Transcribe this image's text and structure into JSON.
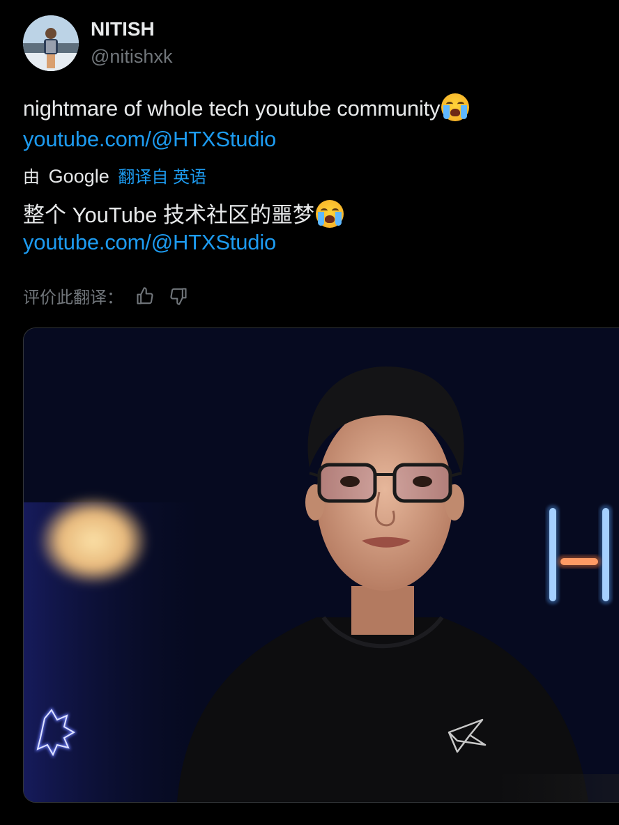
{
  "user": {
    "display_name": "NITISH",
    "handle": "@nitishxk"
  },
  "tweet": {
    "text": "nightmare of whole tech youtube community",
    "emoji": "loudly-crying-face",
    "link": "youtube.com/@HTXStudio"
  },
  "translation": {
    "by_label": "由",
    "provider": "Google",
    "translated_from": "翻译自 英语",
    "text": "整个 YouTube 技术社区的噩梦",
    "link": "youtube.com/@HTXStudio"
  },
  "rate": {
    "label": "评价此翻译："
  },
  "colors": {
    "background": "#000000",
    "text": "#e7e9ea",
    "muted": "#71767b",
    "link": "#1d9bf0"
  }
}
